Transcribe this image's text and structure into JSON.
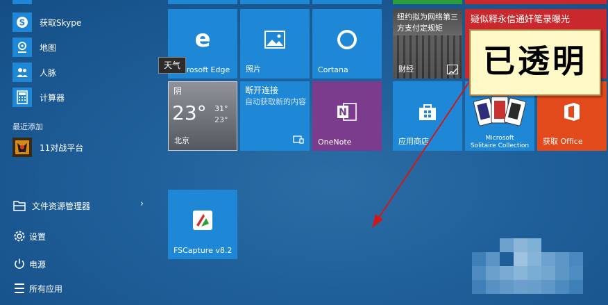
{
  "start_menu": {
    "apps": [
      {
        "label": "获取Skype",
        "icon": "skype-icon"
      },
      {
        "label": "地图",
        "icon": "maps-icon"
      },
      {
        "label": "人脉",
        "icon": "people-icon"
      },
      {
        "label": "计算器",
        "icon": "calculator-icon"
      }
    ],
    "recent_header": "最近添加",
    "recent_app": {
      "label": "11对战平台",
      "icon": "game-platform-icon"
    },
    "system": {
      "file_explorer": "文件资源管理器",
      "settings": "设置",
      "power": "电源",
      "all_apps": "所有应用"
    }
  },
  "tiles": {
    "edge": "Microsoft Edge",
    "photos": "照片",
    "cortana": "Cortana",
    "weather": {
      "condition": "阴",
      "temp": "23°",
      "high": "31°",
      "low": "23°",
      "city": "北京"
    },
    "news_app": {
      "title": "断开连接",
      "body": "自动获取新的内容"
    },
    "onenote": "OneNote",
    "finance": {
      "headline": "纽约拟为网络第三方支付定规矩",
      "label": "财经"
    },
    "news_headline": "疑似释永信通奸笔录曝光",
    "store": "应用商店",
    "solitaire": {
      "line1": "Microsoft",
      "line2": "Solitaire Collection"
    },
    "office": "获取 Office",
    "fscapture": "FSCapture v8.2"
  },
  "tooltip": "天气",
  "annotation": "已透明",
  "colors": {
    "tile_blue": "#1e88d6",
    "onenote": "#7b3c8d",
    "office": "#e24a1c",
    "green": "#2a9e3a",
    "arrow": "#d01818"
  }
}
